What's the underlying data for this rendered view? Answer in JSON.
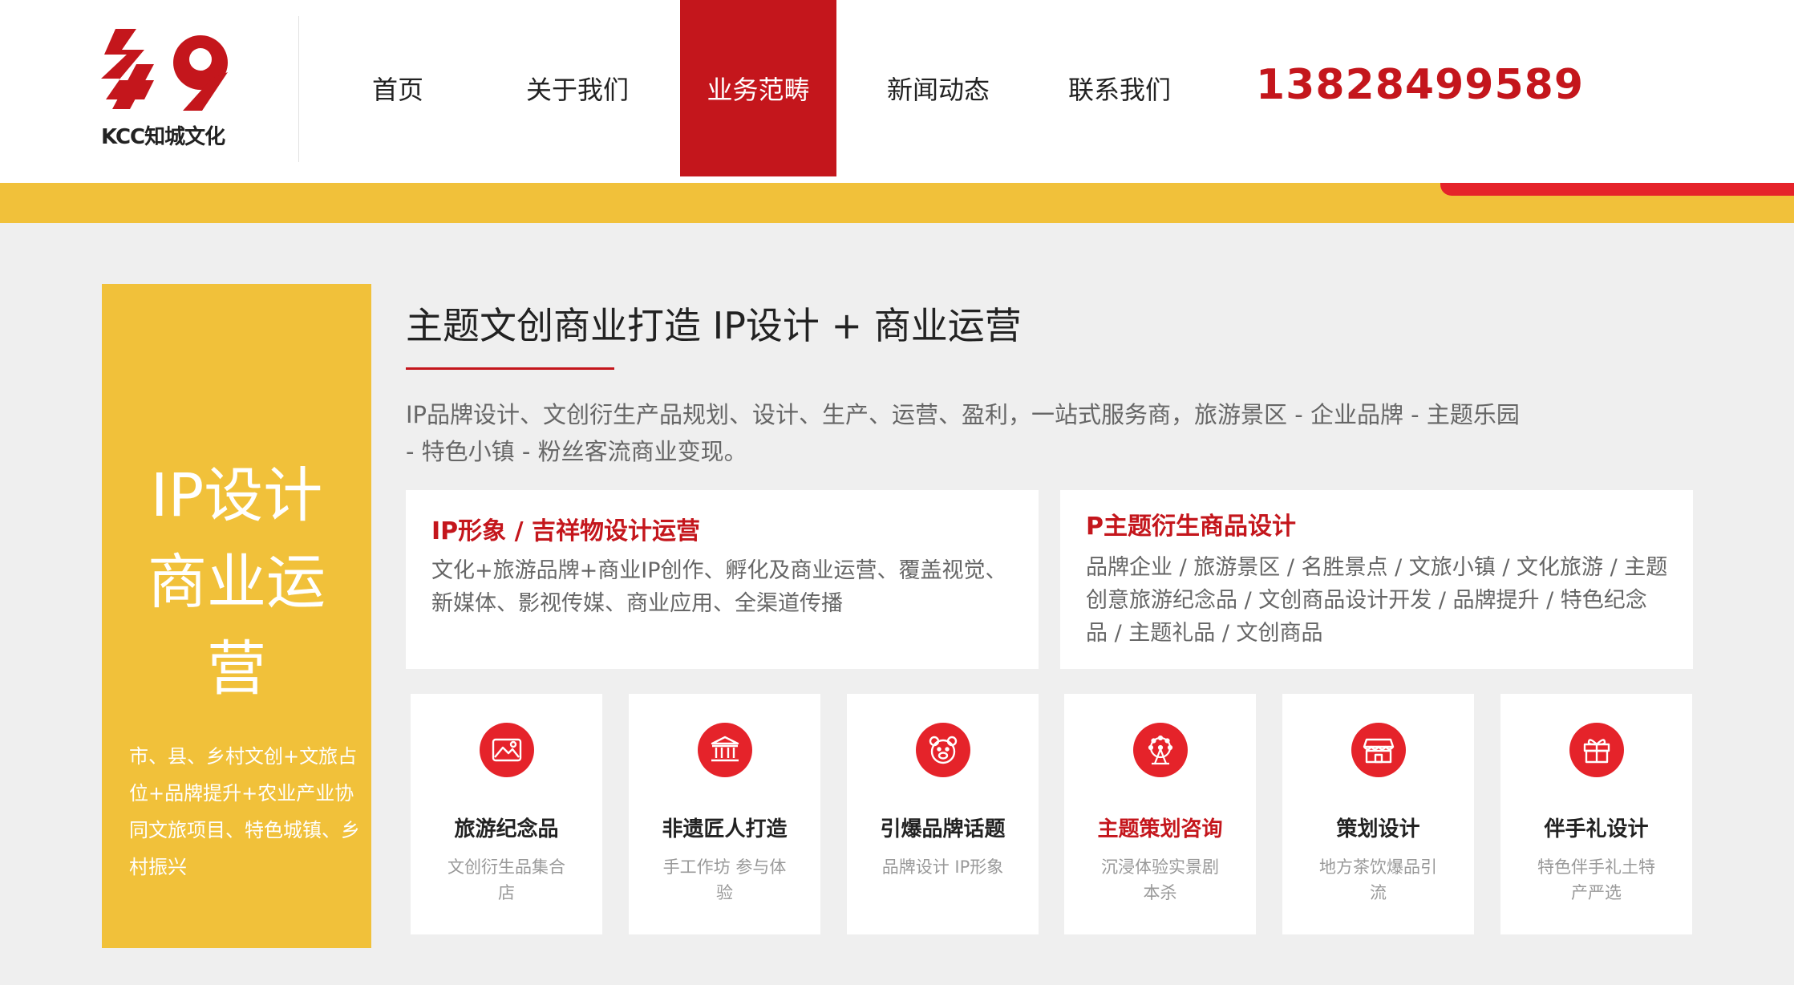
{
  "brand": {
    "logo_mark": "乡9",
    "logo_text": "KCC知城文化"
  },
  "nav": {
    "items": [
      {
        "label": "首页"
      },
      {
        "label": "关于我们"
      },
      {
        "label": "业务范畴",
        "active": true
      },
      {
        "label": "新闻动态"
      },
      {
        "label": "联系我们"
      }
    ],
    "phone": "13828499589"
  },
  "sidebar": {
    "title_lines": [
      "IP设计",
      "商业运",
      "营"
    ],
    "description": "市、县、乡村文创+文旅占位+品牌提升+农业产业协同文旅项目、特色城镇、乡村振兴"
  },
  "main": {
    "title": "主题文创商业打造 IP设计 + 商业运营",
    "intro": "IP品牌设计、文创衍生产品规划、设计、生产、运营、盈利，一站式服务商，旅游景区 - 企业品牌 - 主题乐园 - 特色小镇 - 粉丝客流商业变现。"
  },
  "features": [
    {
      "title": "IP形象 / 吉祥物设计运营",
      "description": "文化+旅游品牌+商业IP创作、孵化及商业运营、覆盖视觉、新媒体、影视传媒、商业应用、全渠道传播"
    },
    {
      "title": "P主题衍生商品设计",
      "description": "品牌企业 / 旅游景区 / 名胜景点 / 文旅小镇 / 文化旅游 / 主题创意旅游纪念品 / 文创商品设计开发 / 品牌提升 / 特色纪念品 / 主题礼品 / 文创商品"
    }
  ],
  "services": [
    {
      "icon": "landscape-icon",
      "title": "旅游纪念品",
      "description": "文创衍生品集合店"
    },
    {
      "icon": "temple-icon",
      "title": "非遗匠人打造",
      "description": "手工作坊 参与体验"
    },
    {
      "icon": "bear-icon",
      "title": "引爆品牌话题",
      "description": "品牌设计 IP形象"
    },
    {
      "icon": "ferris-wheel-icon",
      "title": "主题策划咨询",
      "description": "沉浸体验实景剧本杀",
      "highlight": true
    },
    {
      "icon": "storefront-icon",
      "title": "策划设计",
      "description": "地方茶饮爆品引流"
    },
    {
      "icon": "gift-icon",
      "title": "伴手礼设计",
      "description": "特色伴手礼土特产严选"
    }
  ],
  "colors": {
    "brand_red": "#c4161c",
    "icon_red": "#e5232a",
    "yellow": "#f1c13a"
  }
}
